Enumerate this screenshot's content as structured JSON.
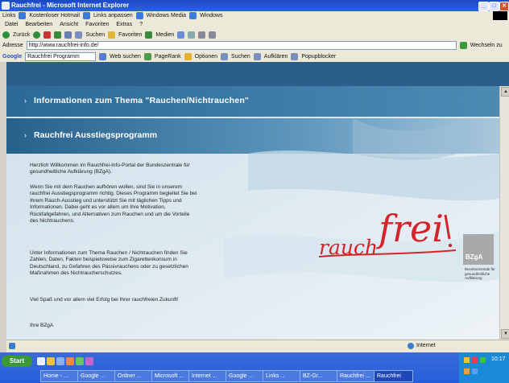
{
  "window": {
    "title": "Rauchfrei - Microsoft Internet Explorer"
  },
  "menu": [
    "Datei",
    "Bearbeiten",
    "Ansicht",
    "Favoriten",
    "Extras",
    "?"
  ],
  "links_bar": [
    "Links",
    "Kostenloser Hotmail",
    "Links anpassen",
    "Windows Media",
    "Windows"
  ],
  "nav": {
    "back": "Zurück",
    "search": "Suchen",
    "favorites": "Favoriten",
    "media": "Medien"
  },
  "address": {
    "label": "Adresse",
    "value": "http://www.rauchfrei-info.de/",
    "go": "Wechseln zu"
  },
  "google": {
    "logo": "Google",
    "search_value": "Rauchfrei Programm",
    "web": "Web suchen",
    "pagerank": "PageRank",
    "options": [
      "Optionen",
      "Suchen",
      "Aufklären",
      "Popupblocker"
    ]
  },
  "content": {
    "banner1": "Informationen zum Thema \"Rauchen/Nichtrauchen\"",
    "banner2": "Rauchfrei Ausstiegsprogramm",
    "paragraphs": [
      "Herzlich Willkommen im Rauchfrei-Info-Portal der Bundeszentrale für gesundheitliche Aufklärung (BZgA).",
      "Wenn Sie mit dem Rauchen aufhören wollen, sind Sie in unserem rauchfrei Ausstiegsprogramm richtig. Dieses Programm begleitet Sie bei Ihrem Rauch-Ausstieg und unterstützt Sie mit täglichen Tipps und Informationen. Dabei geht es vor allem um Ihre Motivation, Rückfallgefahren, und Alternativen zum Rauchen und um die Vorteile des Nichtrauchens.",
      "Unter Informationen zum Thema Rauchen / Nichtrauchen finden Sie Zahlen, Daten, Fakten beispielsweise zum Zigarettenkonsum in Deutschland, zu Gefahren des Passivrauchens oder zu gesetzlichen Maßnahmen des Nichtraucherschutzes.",
      "Viel Spaß und vor allem viel Erfolg bei Ihrer rauchfreien Zukunft!",
      "Ihre BZgA"
    ],
    "logo_word1": "rauch",
    "logo_word2": "frei",
    "bzga_short": "BZgA",
    "bzga_full": "Bundeszentrale für gesundheitliche Aufklärung"
  },
  "status": {
    "zone": "Internet"
  },
  "taskbar": {
    "start": "Start",
    "tasks": [
      "Home - ...",
      "Google ...",
      "Ordner ...",
      "Microsoft ...",
      "Internet ...",
      "Google ...",
      "Links ...",
      "BZ-Gr...",
      "Rauchfrei ...",
      "Rauchfrei"
    ],
    "clock": "10:17"
  },
  "colors": {
    "banner_blue": "#2f6f9a",
    "logo_red": "#d4242b",
    "taskbar_blue": "#245edb"
  }
}
